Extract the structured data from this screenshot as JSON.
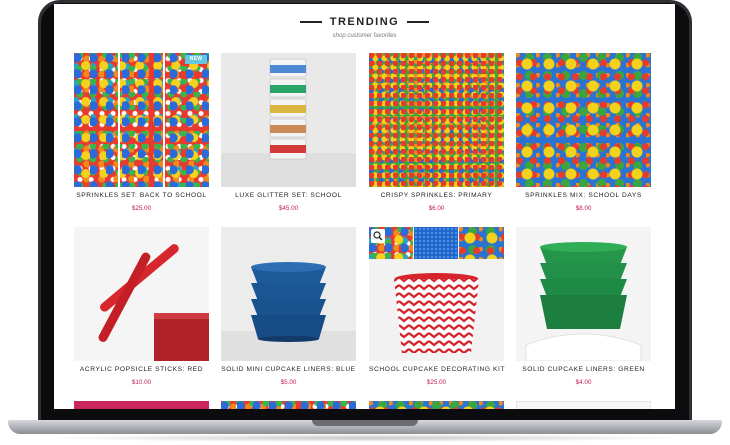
{
  "section": {
    "title": "TRENDING",
    "subtitle": "shop customer favorites"
  },
  "products": [
    {
      "name": "SPRINKLES SET: BACK TO SCHOOL",
      "price": "$25.00",
      "badge": "NEW",
      "image": "sprinkles-strips"
    },
    {
      "name": "LUXE GLITTER SET: SCHOOL",
      "price": "$45.00",
      "image": "glitter-jar-stack"
    },
    {
      "name": "CRISPY SPRINKLES: PRIMARY",
      "price": "$6.00",
      "image": "crispy-dots"
    },
    {
      "name": "SPRINKLES MIX: SCHOOL DAYS",
      "price": "$8.00",
      "image": "sprinkle-mix"
    },
    {
      "name": "ACRYLIC POPSICLE STICKS: RED",
      "price": "$10.00",
      "image": "red-popsicle-sticks"
    },
    {
      "name": "SOLID MINI CUPCAKE LINERS: BLUE",
      "price": "$5.00",
      "image": "blue-cupcake-liners"
    },
    {
      "name": "SCHOOL CUPCAKE DECORATING KIT",
      "price": "$25.00",
      "image": "chevron-cupcake-kit",
      "badge_icon": "search-icon"
    },
    {
      "name": "SOLID CUPCAKE LINERS: GREEN",
      "price": "$4.00",
      "image": "green-cupcake-liners"
    }
  ],
  "colors": {
    "price": "#c2185b",
    "new_badge": "#62c7e0",
    "frame": "#2e2f33"
  }
}
